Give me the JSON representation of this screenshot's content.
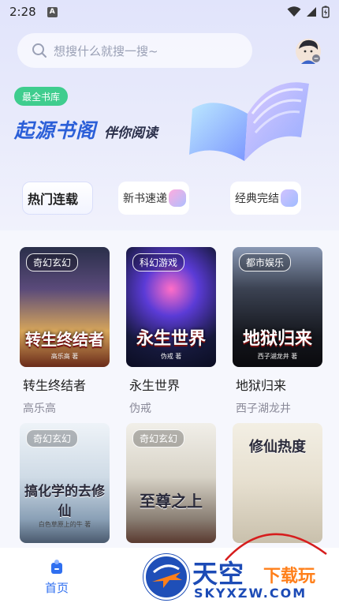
{
  "status_bar": {
    "time": "2:28",
    "notif_letter": "A"
  },
  "search": {
    "placeholder": "想搜什么就搜一搜~"
  },
  "hero": {
    "badge": "最全书库",
    "title": "起源书阁",
    "slogan": "伴你阅读"
  },
  "categories": [
    {
      "label": "热门连载",
      "active": true
    },
    {
      "label": "新书速递",
      "active": false
    },
    {
      "label": "经典完结",
      "active": false
    }
  ],
  "books": [
    {
      "genre": "奇幻玄幻",
      "cover_title": "转生终结者",
      "cover_author": "高乐高 著",
      "name": "转生终结者",
      "author": "高乐高"
    },
    {
      "genre": "科幻游戏",
      "cover_title": "永生世界",
      "cover_author": "伪戒 著",
      "name": "永生世界",
      "author": "伪戒"
    },
    {
      "genre": "都市娱乐",
      "cover_title": "地狱归来",
      "cover_author": "西子湖龙井 著",
      "name": "地狱归来",
      "author": "西子湖龙井"
    },
    {
      "genre": "奇幻玄幻",
      "cover_title": "搞化学的去修仙",
      "cover_author": "白色草原上的牛 著",
      "name": "",
      "author": ""
    },
    {
      "genre": "奇幻玄幻",
      "cover_title": "至尊之上",
      "cover_author": "",
      "name": "",
      "author": ""
    },
    {
      "genre": "",
      "cover_title": "修仙热度",
      "cover_author": "",
      "name": "",
      "author": ""
    }
  ],
  "nav": {
    "home_label": "首页"
  },
  "watermark": {
    "title": "天空",
    "subtitle": "下载玩",
    "url": "SKYXZW.COM"
  }
}
